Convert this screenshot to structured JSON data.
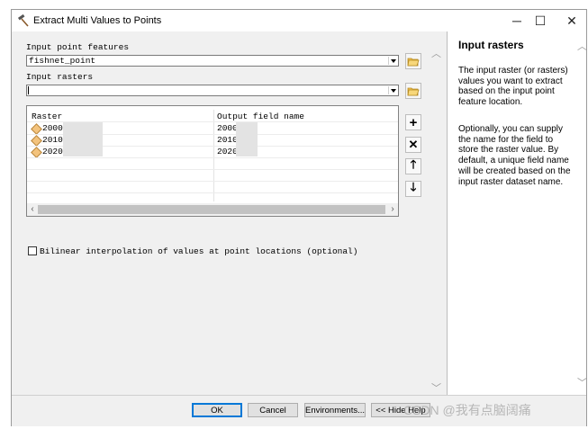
{
  "window": {
    "title": "Extract Multi Values to Points",
    "minimize": "─",
    "maximize": "☐",
    "close": "✕"
  },
  "form": {
    "input_point_label": "Input point features",
    "input_point_value": "fishnet_point",
    "input_rasters_label": "Input rasters",
    "input_rasters_value": "",
    "table": {
      "headers": [
        "Raster",
        "Output field name"
      ],
      "rows": [
        {
          "raster": "2000",
          "field": "2000"
        },
        {
          "raster": "2010",
          "field": "2010r"
        },
        {
          "raster": "2020",
          "field": "2020r"
        }
      ]
    },
    "bilinear_label": "Bilinear interpolation of values at point locations (optional)"
  },
  "help": {
    "title": "Input rasters",
    "para1": "The input raster (or rasters) values you want to extract based on the input point feature location.",
    "para2": "Optionally, you can supply the name for the field to store the raster value. By default, a unique field name will be created based on the input raster dataset name."
  },
  "buttons": {
    "ok": "OK",
    "cancel": "Cancel",
    "environments": "Environments...",
    "hide_help": "<< Hide Help"
  },
  "watermark": "CSDN @我有点脑阔痛"
}
